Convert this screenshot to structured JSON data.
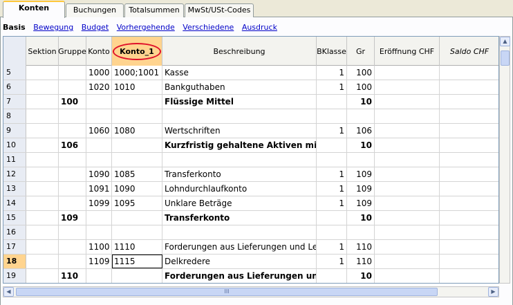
{
  "tabs": [
    {
      "label": "Konten",
      "active": true
    },
    {
      "label": "Buchungen",
      "active": false
    },
    {
      "label": "Totalsummen",
      "active": false
    },
    {
      "label": "MwSt/USt-Codes",
      "active": false
    }
  ],
  "views": [
    {
      "label": "Basis",
      "active": true
    },
    {
      "label": "Bewegung",
      "active": false
    },
    {
      "label": "Budget",
      "active": false
    },
    {
      "label": "Vorhergehende",
      "active": false
    },
    {
      "label": "Verschiedene",
      "active": false
    },
    {
      "label": "Ausdruck",
      "active": false
    }
  ],
  "columns": [
    "Sektion",
    "Gruppe",
    "Konto",
    "Konto_1",
    "Beschreibung",
    "BKlasse",
    "Gr",
    "Eröffnung CHF",
    "Saldo CHF"
  ],
  "rows": [
    {
      "n": "5",
      "sektion": "",
      "gruppe": "",
      "konto": "1000",
      "konto1": "1000;1001",
      "beschreibung": "Kasse",
      "bklasse": "1",
      "gr": "100",
      "bold": false
    },
    {
      "n": "6",
      "sektion": "",
      "gruppe": "",
      "konto": "1020",
      "konto1": "1010",
      "beschreibung": "Bankguthaben",
      "bklasse": "1",
      "gr": "100",
      "bold": false
    },
    {
      "n": "7",
      "sektion": "",
      "gruppe": "100",
      "konto": "",
      "konto1": "",
      "beschreibung": "Flüssige Mittel",
      "bklasse": "",
      "gr": "10",
      "bold": true
    },
    {
      "n": "8",
      "sektion": "",
      "gruppe": "",
      "konto": "",
      "konto1": "",
      "beschreibung": "",
      "bklasse": "",
      "gr": "",
      "bold": false
    },
    {
      "n": "9",
      "sektion": "",
      "gruppe": "",
      "konto": "1060",
      "konto1": "1080",
      "beschreibung": "Wertschriften",
      "bklasse": "1",
      "gr": "106",
      "bold": false
    },
    {
      "n": "10",
      "sektion": "",
      "gruppe": "106",
      "konto": "",
      "konto1": "",
      "beschreibung": "Kurzfristig gehaltene Aktiven mit Bö",
      "bklasse": "",
      "gr": "10",
      "bold": true
    },
    {
      "n": "11",
      "sektion": "",
      "gruppe": "",
      "konto": "",
      "konto1": "",
      "beschreibung": "",
      "bklasse": "",
      "gr": "",
      "bold": false
    },
    {
      "n": "12",
      "sektion": "",
      "gruppe": "",
      "konto": "1090",
      "konto1": "1085",
      "beschreibung": "Transferkonto",
      "bklasse": "1",
      "gr": "109",
      "bold": false
    },
    {
      "n": "13",
      "sektion": "",
      "gruppe": "",
      "konto": "1091",
      "konto1": "1090",
      "beschreibung": "Lohndurchlaufkonto",
      "bklasse": "1",
      "gr": "109",
      "bold": false
    },
    {
      "n": "14",
      "sektion": "",
      "gruppe": "",
      "konto": "1099",
      "konto1": "1095",
      "beschreibung": "Unklare Beträge",
      "bklasse": "1",
      "gr": "109",
      "bold": false
    },
    {
      "n": "15",
      "sektion": "",
      "gruppe": "109",
      "konto": "",
      "konto1": "",
      "beschreibung": "Transferkonto",
      "bklasse": "",
      "gr": "10",
      "bold": true
    },
    {
      "n": "16",
      "sektion": "",
      "gruppe": "",
      "konto": "",
      "konto1": "",
      "beschreibung": "",
      "bklasse": "",
      "gr": "",
      "bold": false
    },
    {
      "n": "17",
      "sektion": "",
      "gruppe": "",
      "konto": "1100",
      "konto1": "1110",
      "beschreibung": "Forderungen aus Lieferungen und Leist",
      "bklasse": "1",
      "gr": "110",
      "bold": false
    },
    {
      "n": "18",
      "sektion": "",
      "gruppe": "",
      "konto": "1109",
      "konto1": "1115",
      "beschreibung": "Delkredere",
      "bklasse": "1",
      "gr": "110",
      "bold": false,
      "current": true
    },
    {
      "n": "19",
      "sektion": "",
      "gruppe": "110",
      "konto": "",
      "konto1": "",
      "beschreibung": "Forderungen aus Lieferungen und",
      "bklasse": "",
      "gr": "10",
      "bold": true
    }
  ],
  "icons": {
    "scroll_up": "scroll-up-arrow-icon",
    "scroll_left": "scroll-left-arrow-icon",
    "scroll_right": "scroll-right-arrow-icon"
  }
}
